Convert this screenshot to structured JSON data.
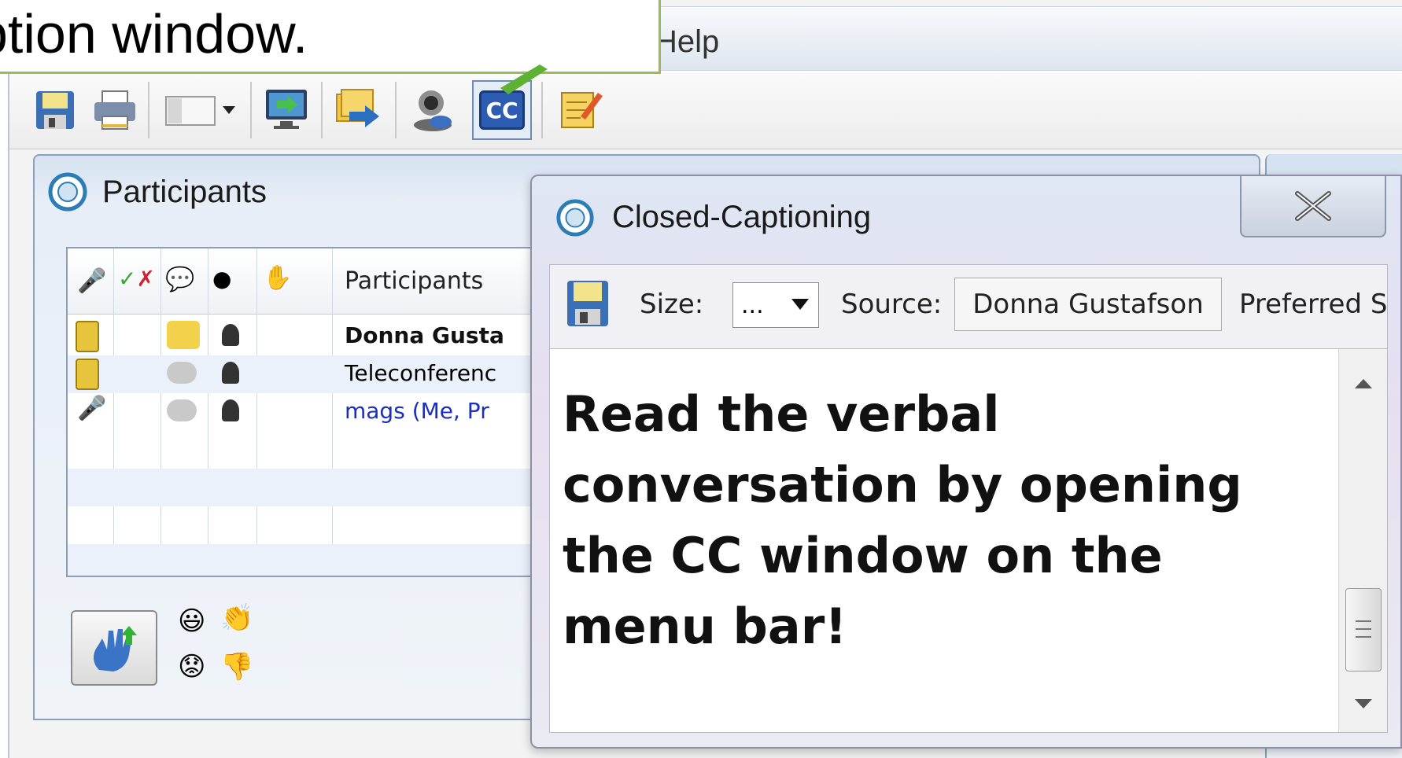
{
  "callout": {
    "text": "ption window."
  },
  "menubar": {
    "help_label": "Help"
  },
  "toolbar": {
    "buttons": [
      "save-icon",
      "print-icon",
      "layout-icon",
      "share-screen-icon",
      "transfer-icon",
      "webcam-icon",
      "cc-icon",
      "notes-icon"
    ],
    "cc_label": "CC"
  },
  "participants_panel": {
    "title": "Participants",
    "table": {
      "header_label": "Participants",
      "header_icons": [
        "microphone-icon",
        "yes-no-icon",
        "chat-icon",
        "webcam-icon",
        "raise-hand-icon"
      ],
      "rows": [
        {
          "name": "Donna Gusta",
          "style": "bold",
          "icon": "phone-icon",
          "chat_active": true
        },
        {
          "name": "Teleconferenc",
          "style": "normal",
          "icon": "phone-icon",
          "chat_active": false
        },
        {
          "name": "mags (Me, Pr",
          "style": "me",
          "icon": "microphone-icon",
          "chat_active": false
        }
      ]
    },
    "emotes": [
      "smile-icon",
      "clap-icon",
      "sad-icon",
      "thumbs-down-icon"
    ]
  },
  "cc_window": {
    "title": "Closed-Captioning",
    "size_label": "Size:",
    "size_value": "...",
    "source_label": "Source:",
    "source_value": "Donna Gustafson",
    "preferred_label": "Preferred S",
    "caption_text": "Read the verbal conversation by opening the CC window on the menu bar!"
  },
  "colors": {
    "callout_border": "#9bbb59",
    "me_text": "#1a2fbf"
  }
}
